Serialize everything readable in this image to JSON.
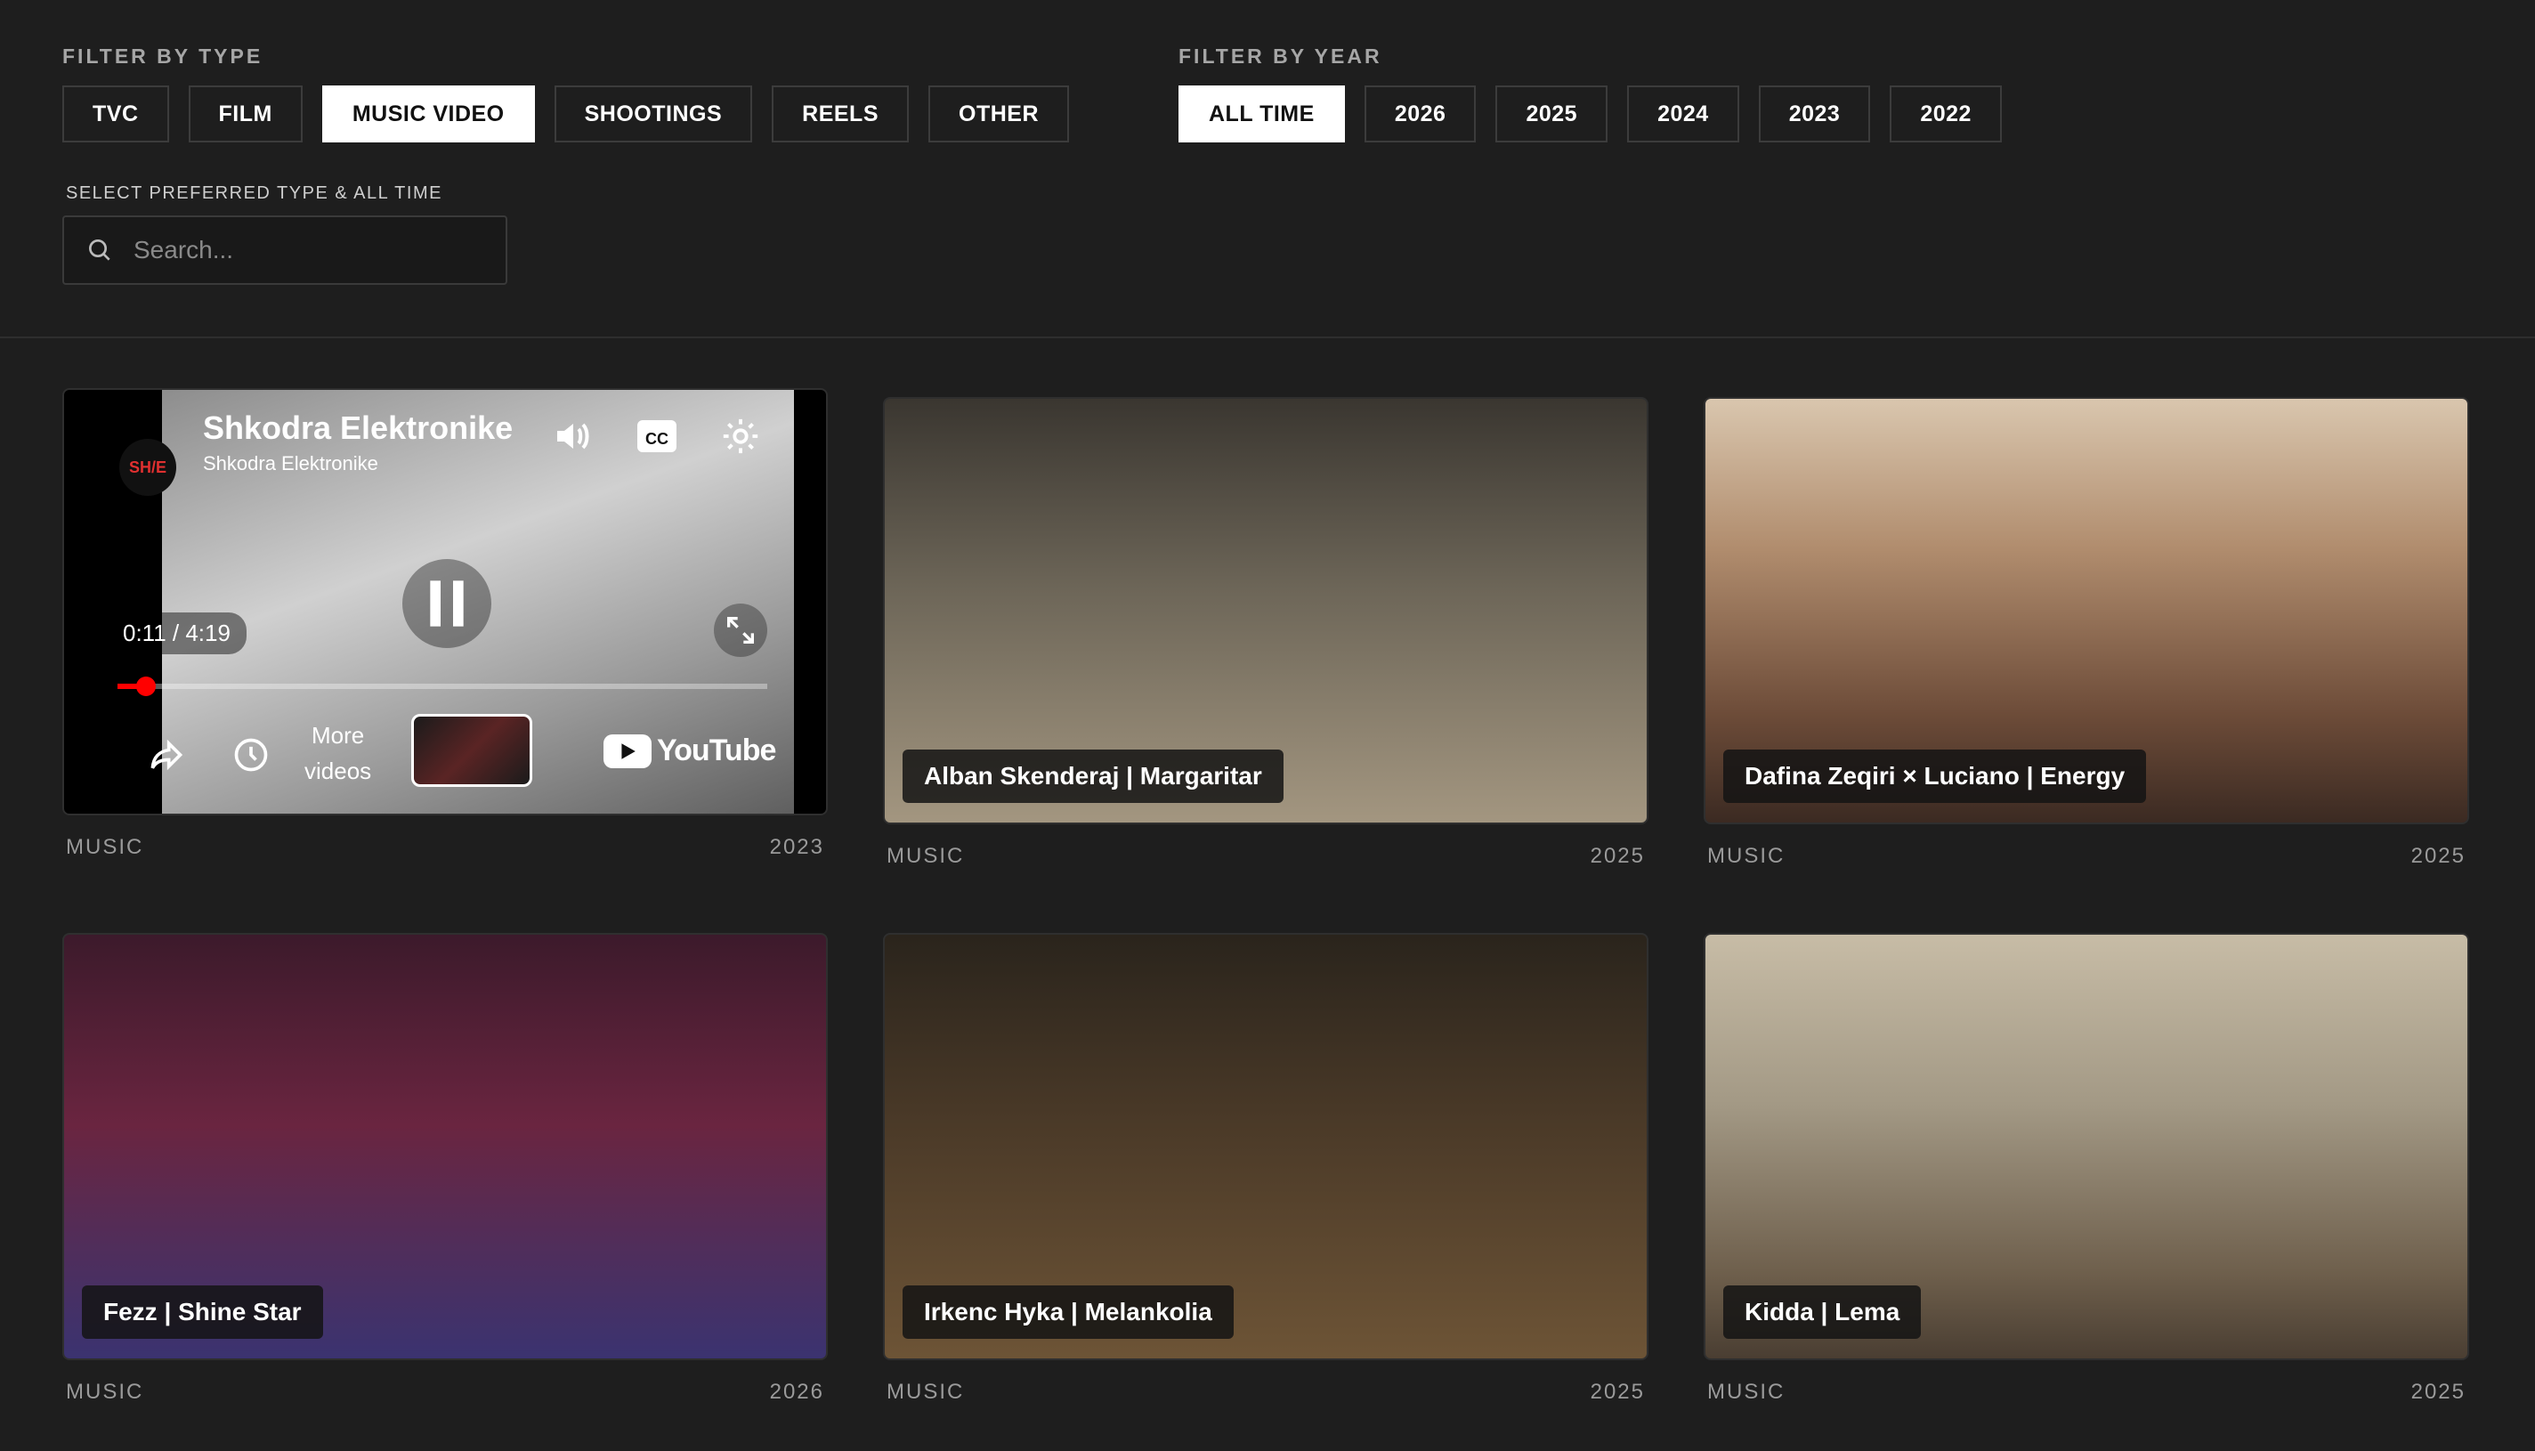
{
  "filters": {
    "type_label": "FILTER BY TYPE",
    "type_buttons": [
      "TVC",
      "FILM",
      "MUSIC VIDEO",
      "SHOOTINGS",
      "REELS",
      "OTHER"
    ],
    "type_active": "MUSIC VIDEO",
    "year_label": "FILTER BY YEAR",
    "year_buttons": [
      "ALL TIME",
      "2026",
      "2025",
      "2024",
      "2023",
      "2022"
    ],
    "year_active": "ALL TIME",
    "hint": "SELECT PREFERRED TYPE & ALL TIME",
    "search_placeholder": "Search..."
  },
  "player": {
    "title": "Shkodra Elektronike",
    "channel": "Shkodra Elektronike",
    "logo_text": "SH/E",
    "time": "0:11 / 4:19",
    "progress_fraction": 0.044,
    "more_videos_line1": "More",
    "more_videos_line2": "videos",
    "youtube_label": "YouTube",
    "category": "MUSIC",
    "year": "2023"
  },
  "cards": [
    {
      "title": "Alban Skenderaj | Margaritar",
      "category": "MUSIC",
      "year": "2025"
    },
    {
      "title": "Dafina Zeqiri × Luciano | Energy",
      "category": "MUSIC",
      "year": "2025"
    },
    {
      "title": "Fezz | Shine Star",
      "category": "MUSIC",
      "year": "2026"
    },
    {
      "title": "Irkenc Hyka | Melankolia",
      "category": "MUSIC",
      "year": "2025"
    },
    {
      "title": "Kidda | Lema",
      "category": "MUSIC",
      "year": "2025"
    }
  ],
  "colors": {
    "background": "#1e1e1e",
    "active_button": "#ffffff",
    "progress": "#ff0000"
  }
}
